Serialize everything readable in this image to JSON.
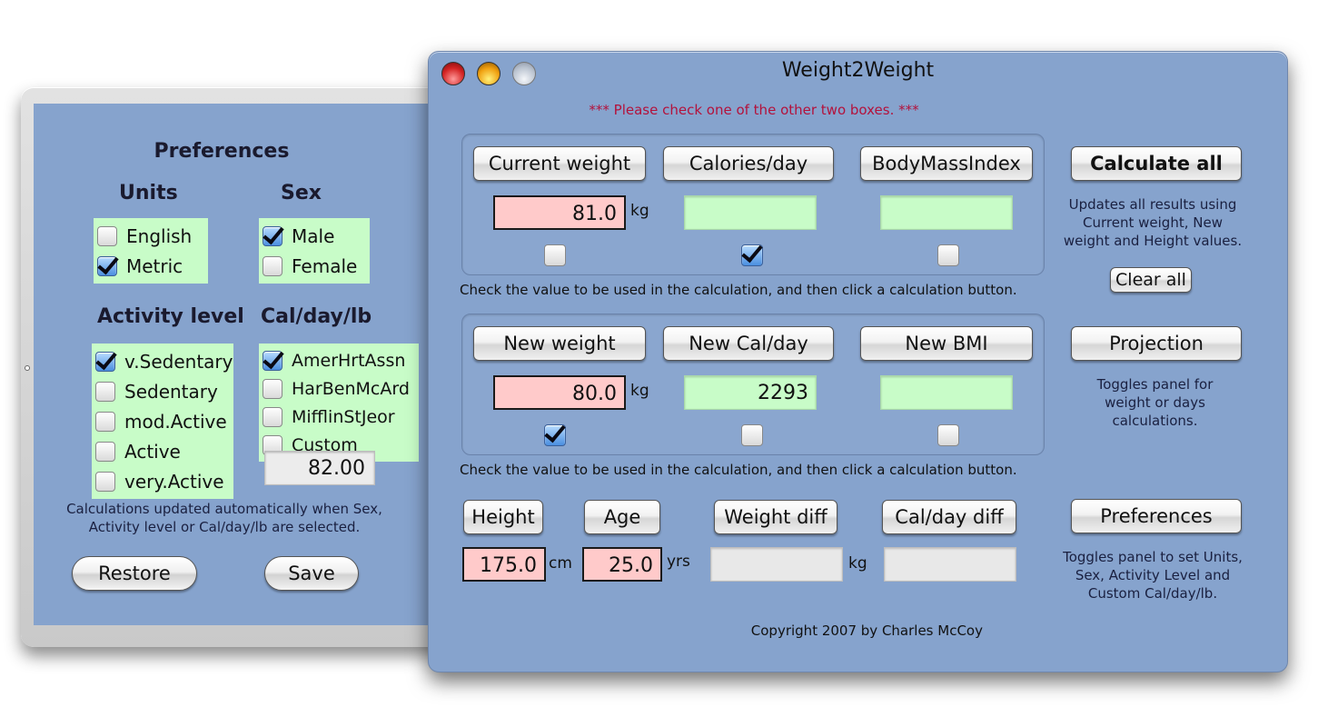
{
  "preferences_panel": {
    "title": "Preferences",
    "units": {
      "title": "Units",
      "options": [
        {
          "label": "English",
          "checked": false
        },
        {
          "label": "Metric",
          "checked": true
        }
      ]
    },
    "sex": {
      "title": "Sex",
      "options": [
        {
          "label": "Male",
          "checked": true
        },
        {
          "label": "Female",
          "checked": false
        }
      ]
    },
    "activity_level": {
      "title": "Activity level",
      "options": [
        {
          "label": "v.Sedentary",
          "checked": true
        },
        {
          "label": "Sedentary",
          "checked": false
        },
        {
          "label": "mod.Active",
          "checked": false
        },
        {
          "label": "Active",
          "checked": false
        },
        {
          "label": "very.Active",
          "checked": false
        }
      ]
    },
    "cal_day_lb": {
      "title": "Cal/day/lb",
      "options": [
        {
          "label": "AmerHrtAssn",
          "checked": true
        },
        {
          "label": "HarBenMcArd",
          "checked": false
        },
        {
          "label": "MifflinStJeor",
          "checked": false
        },
        {
          "label": "Custom",
          "checked": false
        }
      ],
      "value": "82.00"
    },
    "note": "Calculations updated automatically when Sex, Activity level or Cal/day/lb are selected.",
    "restore_label": "Restore",
    "save_label": "Save"
  },
  "main_window": {
    "title": "Weight2Weight",
    "warning": "*** Please check one of the other two boxes. ***",
    "current_group": {
      "buttons": [
        "Current weight",
        "Calories/day",
        "BodyMassIndex"
      ],
      "values": [
        "81.0",
        "",
        ""
      ],
      "weight_unit": "kg",
      "checks": [
        false,
        true,
        false
      ]
    },
    "new_group": {
      "buttons": [
        "New weight",
        "New Cal/day",
        "New BMI"
      ],
      "values": [
        "80.0",
        "2293",
        ""
      ],
      "weight_unit": "kg",
      "checks": [
        true,
        false,
        false
      ]
    },
    "helper_text": "Check the value to be used in the calculation, and then click a calculation button.",
    "bottom": {
      "height_label": "Height",
      "height_value": "175.0",
      "height_unit": "cm",
      "age_label": "Age",
      "age_value": "25.0",
      "age_unit": "yrs",
      "weight_diff_label": "Weight diff",
      "weight_diff_value": "",
      "weight_diff_unit": "kg",
      "cal_diff_label": "Cal/day diff",
      "cal_diff_value": ""
    },
    "side": {
      "calculate_all_label": "Calculate all",
      "calculate_all_note": "Updates all results using Current weight, New weight and Height values.",
      "clear_all_label": "Clear all",
      "projection_label": "Projection",
      "projection_note": "Toggles panel for weight or days calculations.",
      "preferences_label": "Preferences",
      "preferences_note": "Toggles panel to set Units, Sex, Activity Level and Custom Cal/day/lb."
    },
    "copyright": "Copyright 2007 by Charles McCoy"
  }
}
